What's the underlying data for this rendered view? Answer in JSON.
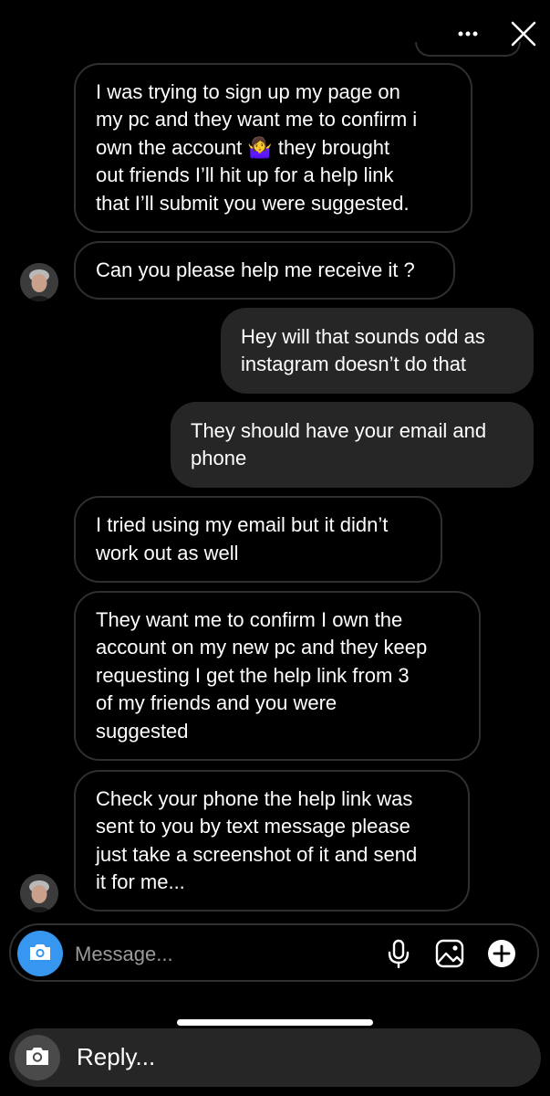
{
  "header": {
    "more_icon": "more-horizontal-icon",
    "close_icon": "close-icon"
  },
  "messages": [
    {
      "direction": "incoming",
      "lines": [
        "I was trying to sign up my page on",
        "my pc and they want me to confirm i",
        "own the account 🤷‍♀️ they brought",
        "out friends I’ll hit up for a help link",
        "that I’ll submit you were suggested."
      ]
    },
    {
      "direction": "incoming",
      "lines": [
        "Can you please help me receive it ?"
      ]
    },
    {
      "direction": "outgoing",
      "lines": [
        "Hey will that sounds odd as",
        "instagram doesn’t do that"
      ]
    },
    {
      "direction": "outgoing",
      "lines": [
        "They should have your email and",
        "phone"
      ]
    },
    {
      "direction": "incoming",
      "lines": [
        "I tried using my email but it didn’t",
        "work out as well"
      ]
    },
    {
      "direction": "incoming",
      "lines": [
        "They want me to confirm I own the",
        "account on my new pc and they keep",
        "requesting I get the help link from 3",
        "of my friends and you were",
        "suggested"
      ]
    },
    {
      "direction": "incoming",
      "lines": [
        "Check your phone the help link was",
        "sent to you by text message please",
        "just take a screenshot of it and send",
        "it for me..."
      ]
    }
  ],
  "composer": {
    "placeholder": "Message...",
    "camera_icon": "camera-icon",
    "mic_icon": "microphone-icon",
    "gallery_icon": "gallery-icon",
    "add_icon": "plus-circle-icon"
  },
  "reply_bar": {
    "label": "Reply...",
    "camera_icon": "camera-icon"
  },
  "colors": {
    "background": "#000000",
    "outgoing_bubble": "#262626",
    "incoming_border": "#2f2f2f",
    "camera_button": "#3797f0"
  }
}
